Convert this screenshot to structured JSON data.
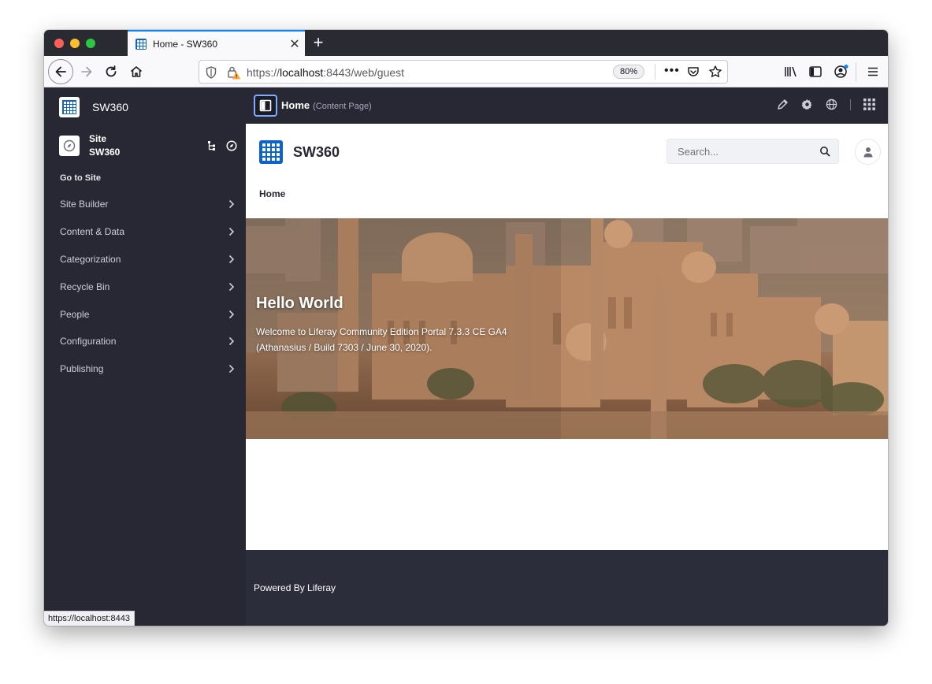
{
  "browser": {
    "tab_title": "Home - SW360",
    "url_prefix": "https://",
    "url_host": "localhost",
    "url_rest": ":8443/web/guest",
    "zoom": "80%",
    "status_url": "https://localhost:8443"
  },
  "sidebar": {
    "brand": "SW360",
    "site_label": "Site",
    "site_name": "SW360",
    "go_to_site": "Go to Site",
    "items": [
      {
        "label": "Site Builder"
      },
      {
        "label": "Content & Data"
      },
      {
        "label": "Categorization"
      },
      {
        "label": "Recycle Bin"
      },
      {
        "label": "People"
      },
      {
        "label": "Configuration"
      },
      {
        "label": "Publishing"
      }
    ]
  },
  "control_bar": {
    "title": "Home",
    "subtitle": "(Content Page)"
  },
  "header": {
    "site_name": "SW360",
    "search_placeholder": "Search...",
    "nav_home": "Home"
  },
  "hero": {
    "title": "Hello World",
    "body": "Welcome to Liferay Community Edition Portal 7.3.3 CE GA4 (Athanasius / Build 7303 / June 30, 2020)."
  },
  "footer": {
    "text": "Powered By Liferay"
  },
  "colors": {
    "sidebar_bg": "#272833",
    "accent": "#0b63ce",
    "footer_bg": "#2b2d3a"
  }
}
